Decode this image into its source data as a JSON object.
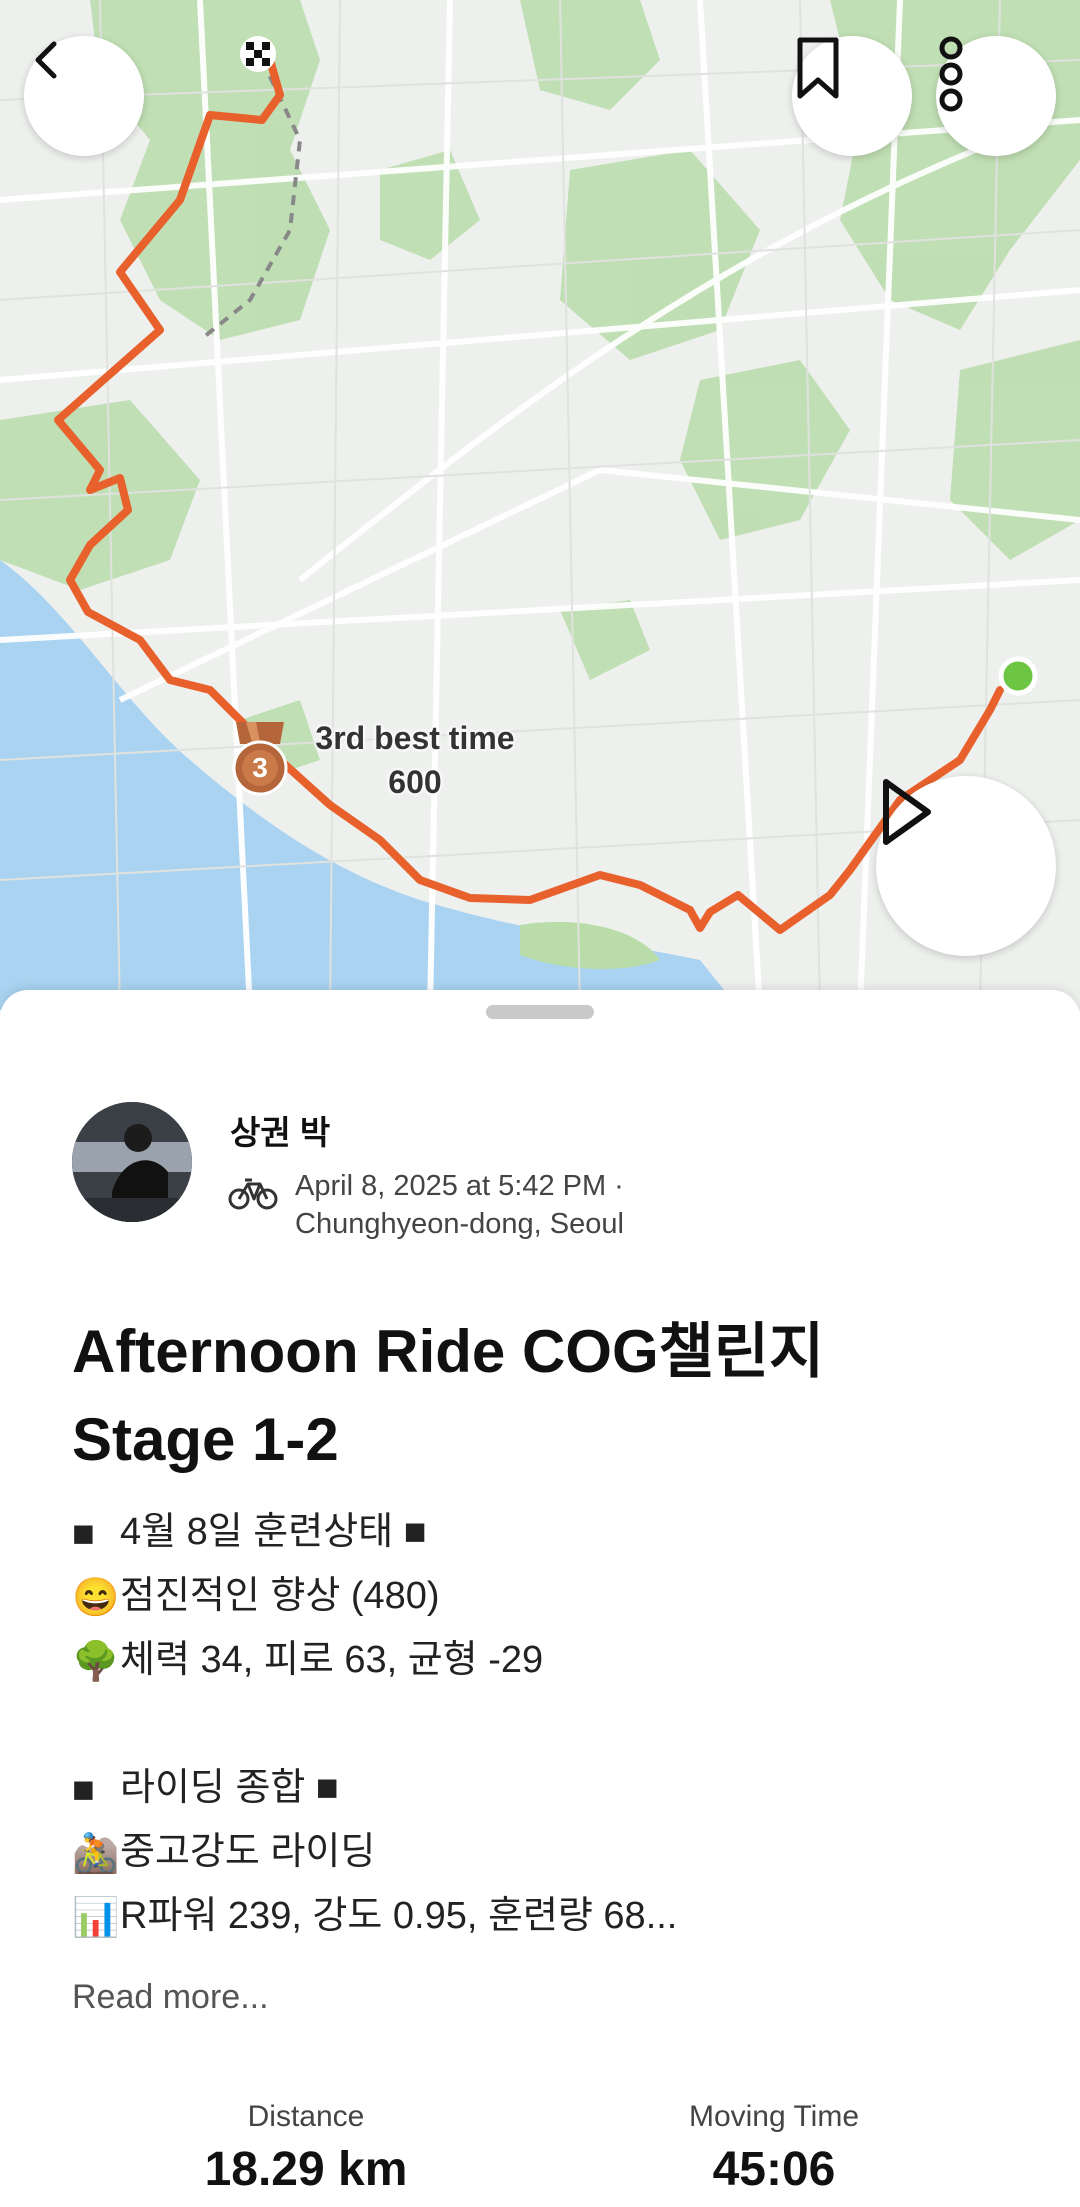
{
  "map": {
    "medal_rank": "3",
    "medal_title": "3rd best time",
    "medal_value": "600"
  },
  "header_buttons": {
    "back_icon": "chevron-left-icon",
    "bookmark_icon": "bookmark-icon",
    "more_icon": "more-vertical-icon",
    "play_icon": "play-icon"
  },
  "activity": {
    "author_name": "상권 박",
    "sport_icon": "bicycle-icon",
    "datetime": "April 8, 2025 at 5:42 PM ·",
    "location": "Chunghyeon-dong, Seoul",
    "title_line1": "Afternoon Ride COG챌린지",
    "title_line2": "Stage 1-2",
    "description": [
      {
        "emoji": "■",
        "text": "4월 8일 훈련상태 ■"
      },
      {
        "emoji": "😄",
        "text": "점진적인 향상 (480)"
      },
      {
        "emoji": "🌳",
        "text": "체력 34, 피로 63, 균형 -29"
      },
      {
        "emoji": "",
        "text": ""
      },
      {
        "emoji": "■",
        "text": "라이딩 종합 ■"
      },
      {
        "emoji": "🚵",
        "text": "중고강도 라이딩"
      },
      {
        "emoji": "📊",
        "text": "R파워 239, 강도 0.95, 훈련량 68..."
      }
    ],
    "read_more": "Read more...",
    "stats": [
      {
        "label": "Distance",
        "value": "18.29 km"
      },
      {
        "label": "Moving Time",
        "value": "45:06"
      }
    ]
  },
  "colors": {
    "route": "#e8612c",
    "water": "#a9d3f0",
    "park": "#b9dca9",
    "start_dot": "#6cc644",
    "medal": "#b5653a"
  }
}
